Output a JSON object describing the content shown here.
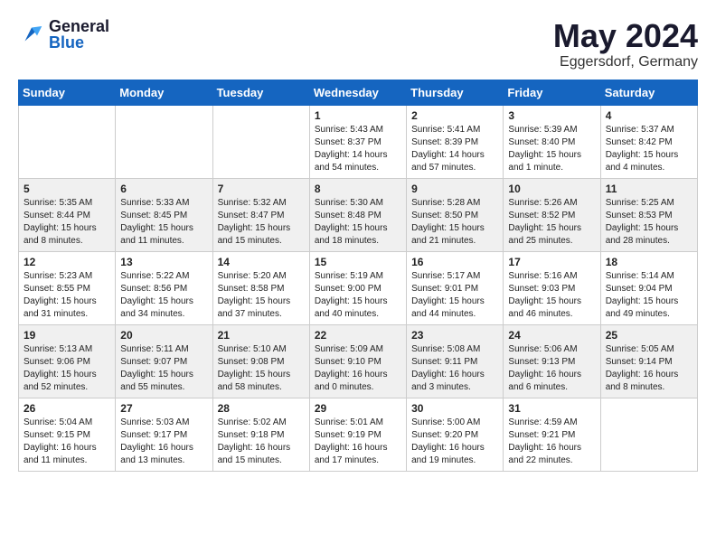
{
  "header": {
    "logo_general": "General",
    "logo_blue": "Blue",
    "month_year": "May 2024",
    "location": "Eggersdorf, Germany"
  },
  "calendar": {
    "days_of_week": [
      "Sunday",
      "Monday",
      "Tuesday",
      "Wednesday",
      "Thursday",
      "Friday",
      "Saturday"
    ],
    "weeks": [
      [
        {
          "day": "",
          "info": ""
        },
        {
          "day": "",
          "info": ""
        },
        {
          "day": "",
          "info": ""
        },
        {
          "day": "1",
          "info": "Sunrise: 5:43 AM\nSunset: 8:37 PM\nDaylight: 14 hours\nand 54 minutes."
        },
        {
          "day": "2",
          "info": "Sunrise: 5:41 AM\nSunset: 8:39 PM\nDaylight: 14 hours\nand 57 minutes."
        },
        {
          "day": "3",
          "info": "Sunrise: 5:39 AM\nSunset: 8:40 PM\nDaylight: 15 hours\nand 1 minute."
        },
        {
          "day": "4",
          "info": "Sunrise: 5:37 AM\nSunset: 8:42 PM\nDaylight: 15 hours\nand 4 minutes."
        }
      ],
      [
        {
          "day": "5",
          "info": "Sunrise: 5:35 AM\nSunset: 8:44 PM\nDaylight: 15 hours\nand 8 minutes."
        },
        {
          "day": "6",
          "info": "Sunrise: 5:33 AM\nSunset: 8:45 PM\nDaylight: 15 hours\nand 11 minutes."
        },
        {
          "day": "7",
          "info": "Sunrise: 5:32 AM\nSunset: 8:47 PM\nDaylight: 15 hours\nand 15 minutes."
        },
        {
          "day": "8",
          "info": "Sunrise: 5:30 AM\nSunset: 8:48 PM\nDaylight: 15 hours\nand 18 minutes."
        },
        {
          "day": "9",
          "info": "Sunrise: 5:28 AM\nSunset: 8:50 PM\nDaylight: 15 hours\nand 21 minutes."
        },
        {
          "day": "10",
          "info": "Sunrise: 5:26 AM\nSunset: 8:52 PM\nDaylight: 15 hours\nand 25 minutes."
        },
        {
          "day": "11",
          "info": "Sunrise: 5:25 AM\nSunset: 8:53 PM\nDaylight: 15 hours\nand 28 minutes."
        }
      ],
      [
        {
          "day": "12",
          "info": "Sunrise: 5:23 AM\nSunset: 8:55 PM\nDaylight: 15 hours\nand 31 minutes."
        },
        {
          "day": "13",
          "info": "Sunrise: 5:22 AM\nSunset: 8:56 PM\nDaylight: 15 hours\nand 34 minutes."
        },
        {
          "day": "14",
          "info": "Sunrise: 5:20 AM\nSunset: 8:58 PM\nDaylight: 15 hours\nand 37 minutes."
        },
        {
          "day": "15",
          "info": "Sunrise: 5:19 AM\nSunset: 9:00 PM\nDaylight: 15 hours\nand 40 minutes."
        },
        {
          "day": "16",
          "info": "Sunrise: 5:17 AM\nSunset: 9:01 PM\nDaylight: 15 hours\nand 44 minutes."
        },
        {
          "day": "17",
          "info": "Sunrise: 5:16 AM\nSunset: 9:03 PM\nDaylight: 15 hours\nand 46 minutes."
        },
        {
          "day": "18",
          "info": "Sunrise: 5:14 AM\nSunset: 9:04 PM\nDaylight: 15 hours\nand 49 minutes."
        }
      ],
      [
        {
          "day": "19",
          "info": "Sunrise: 5:13 AM\nSunset: 9:06 PM\nDaylight: 15 hours\nand 52 minutes."
        },
        {
          "day": "20",
          "info": "Sunrise: 5:11 AM\nSunset: 9:07 PM\nDaylight: 15 hours\nand 55 minutes."
        },
        {
          "day": "21",
          "info": "Sunrise: 5:10 AM\nSunset: 9:08 PM\nDaylight: 15 hours\nand 58 minutes."
        },
        {
          "day": "22",
          "info": "Sunrise: 5:09 AM\nSunset: 9:10 PM\nDaylight: 16 hours\nand 0 minutes."
        },
        {
          "day": "23",
          "info": "Sunrise: 5:08 AM\nSunset: 9:11 PM\nDaylight: 16 hours\nand 3 minutes."
        },
        {
          "day": "24",
          "info": "Sunrise: 5:06 AM\nSunset: 9:13 PM\nDaylight: 16 hours\nand 6 minutes."
        },
        {
          "day": "25",
          "info": "Sunrise: 5:05 AM\nSunset: 9:14 PM\nDaylight: 16 hours\nand 8 minutes."
        }
      ],
      [
        {
          "day": "26",
          "info": "Sunrise: 5:04 AM\nSunset: 9:15 PM\nDaylight: 16 hours\nand 11 minutes."
        },
        {
          "day": "27",
          "info": "Sunrise: 5:03 AM\nSunset: 9:17 PM\nDaylight: 16 hours\nand 13 minutes."
        },
        {
          "day": "28",
          "info": "Sunrise: 5:02 AM\nSunset: 9:18 PM\nDaylight: 16 hours\nand 15 minutes."
        },
        {
          "day": "29",
          "info": "Sunrise: 5:01 AM\nSunset: 9:19 PM\nDaylight: 16 hours\nand 17 minutes."
        },
        {
          "day": "30",
          "info": "Sunrise: 5:00 AM\nSunset: 9:20 PM\nDaylight: 16 hours\nand 19 minutes."
        },
        {
          "day": "31",
          "info": "Sunrise: 4:59 AM\nSunset: 9:21 PM\nDaylight: 16 hours\nand 22 minutes."
        },
        {
          "day": "",
          "info": ""
        }
      ]
    ]
  }
}
